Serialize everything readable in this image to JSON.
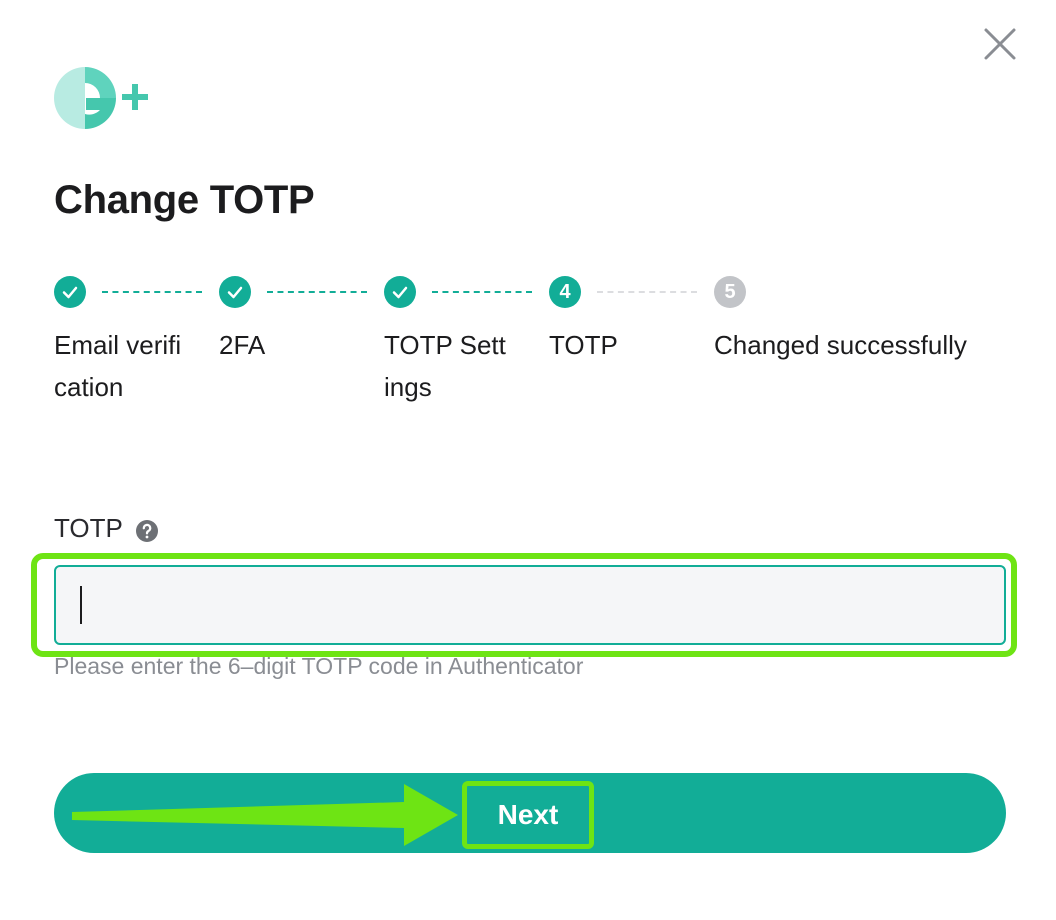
{
  "dialog": {
    "title": "Change TOTP",
    "close_icon": "close-icon"
  },
  "logo": {
    "icon": "brand-logo-g-plus"
  },
  "stepper": {
    "steps": [
      {
        "number": "1",
        "label": "Email verification",
        "state": "done"
      },
      {
        "number": "2",
        "label": "2FA",
        "state": "done"
      },
      {
        "number": "3",
        "label": "TOTP Settings",
        "state": "done"
      },
      {
        "number": "4",
        "label": "TOTP",
        "state": "active"
      },
      {
        "number": "5",
        "label": "Changed successfully",
        "state": "pending"
      }
    ]
  },
  "form": {
    "totp_label": "TOTP",
    "totp_value": "",
    "totp_hint": "Please enter the 6–digit TOTP code in Authenticator"
  },
  "actions": {
    "next_label": "Next"
  },
  "colors": {
    "accent": "#12ad97",
    "pending": "#c2c4c8",
    "annotation": "#6ee414"
  }
}
